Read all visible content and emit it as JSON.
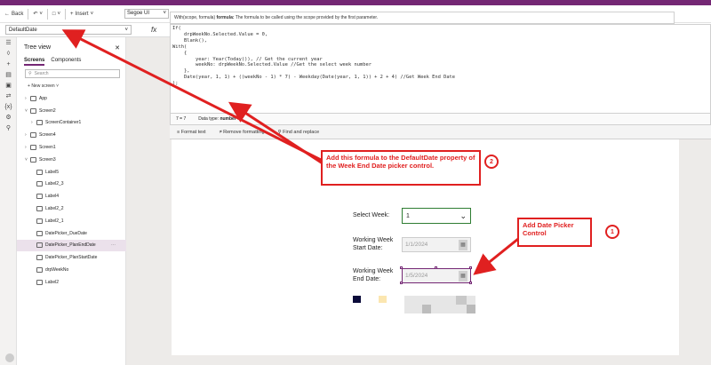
{
  "toolbar": {
    "back_label": "Back",
    "insert_label": "Insert",
    "font_value": "Segoe UI"
  },
  "formula_bar": {
    "property": "DefaultDate",
    "fx_label": "fx"
  },
  "tooltip": {
    "signature": "With(scope, formula)",
    "param": "formula:",
    "description": "The formula to be called using the scope provided by the first parameter."
  },
  "editor": {
    "lines": [
      "If(",
      "    drpWeekNo.Selected.Value = 0,",
      "    Blank(),",
      "With(",
      "    {",
      "        year: Year(Today()), // Get the current year",
      "        weekNo: drpWeekNo.Selected.Value //Get the select week number",
      "    },",
      "    Date(year, 1, 1) + ((weekNo - 1) * 7) - Weekday(Date(year, 1, 1)) + 2 + 4) //Get Week End Date",
      ");"
    ]
  },
  "status": {
    "position": "7 = 7",
    "data_type_label": "Data type:",
    "data_type_value": "number"
  },
  "commands": {
    "format_text": "Format text",
    "remove_formatting": "Remove formatting",
    "find_replace": "Find and replace"
  },
  "tree_view": {
    "title": "Tree view",
    "tabs": [
      "Screens",
      "Components"
    ],
    "search_placeholder": "Search",
    "new_screen": "New screen",
    "items": [
      {
        "label": "App",
        "indent": 1,
        "chev": ">",
        "selected": false
      },
      {
        "label": "Screen2",
        "indent": 1,
        "chev": "v",
        "selected": false
      },
      {
        "label": "ScreenContainer1",
        "indent": 2,
        "chev": ">",
        "selected": false
      },
      {
        "label": "Screen4",
        "indent": 1,
        "chev": ">",
        "selected": false
      },
      {
        "label": "Screen1",
        "indent": 1,
        "chev": ">",
        "selected": false
      },
      {
        "label": "Screen3",
        "indent": 1,
        "chev": "v",
        "selected": false
      },
      {
        "label": "Label5",
        "indent": 2,
        "chev": "",
        "selected": false
      },
      {
        "label": "Label2_3",
        "indent": 2,
        "chev": "",
        "selected": false
      },
      {
        "label": "Label4",
        "indent": 2,
        "chev": "",
        "selected": false
      },
      {
        "label": "Label2_2",
        "indent": 2,
        "chev": "",
        "selected": false
      },
      {
        "label": "Label2_1",
        "indent": 2,
        "chev": "",
        "selected": false
      },
      {
        "label": "DatePicker_DueDate",
        "indent": 2,
        "chev": "",
        "selected": false
      },
      {
        "label": "DatePicker_PlanEndDate",
        "indent": 2,
        "chev": "",
        "selected": true
      },
      {
        "label": "DatePicker_PlanStartDate",
        "indent": 2,
        "chev": "",
        "selected": false
      },
      {
        "label": "drpWeekNo",
        "indent": 2,
        "chev": "",
        "selected": false
      },
      {
        "label": "Label2",
        "indent": 2,
        "chev": "",
        "selected": false
      }
    ]
  },
  "canvas": {
    "select_week_label": "Select Week:",
    "select_week_value": "1",
    "start_label_1": "Working Week",
    "start_label_2": "Start Date:",
    "start_value": "1/1/2024",
    "end_label_1": "Working Week",
    "end_label_2": "End Date:",
    "end_value": "1/5/2024"
  },
  "annotations": {
    "callout_1": "Add this formula to the DefaultDate property of the Week End Date picker control.",
    "callout_2": "Add Date Picker Control",
    "num_1": "2",
    "num_2": "1",
    "arrow_color": "#e02020"
  },
  "colors": {
    "brand": "#742774",
    "accent_green": "#2e7d32",
    "annotation_red": "#e02020"
  }
}
